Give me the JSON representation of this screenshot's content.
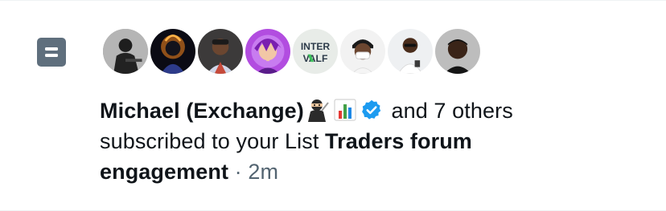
{
  "notification": {
    "type_icon": "list-icon",
    "avatars": [
      {
        "icon": "avatar-user-1"
      },
      {
        "icon": "avatar-user-2"
      },
      {
        "icon": "avatar-user-3"
      },
      {
        "icon": "avatar-user-4"
      },
      {
        "icon": "avatar-user-5",
        "text": "INTERVALF"
      },
      {
        "icon": "avatar-user-6"
      },
      {
        "icon": "avatar-user-7"
      },
      {
        "icon": "avatar-user-8"
      }
    ],
    "actor_name": "Michael (Exchange)",
    "actor_emojis": [
      "ninja-emoji",
      "bar-chart-emoji"
    ],
    "verified_icon": "verified-badge-icon",
    "others_text": "and 7 others",
    "action_text": "subscribed to your List",
    "list_name": "Traders forum engagement",
    "separator": "·",
    "timestamp": "2m"
  },
  "colors": {
    "text": "#0f1419",
    "muted": "#536471",
    "verified": "#1d9bf0",
    "list_icon_bg": "#5f6f7d",
    "divider": "#eff3f4"
  }
}
